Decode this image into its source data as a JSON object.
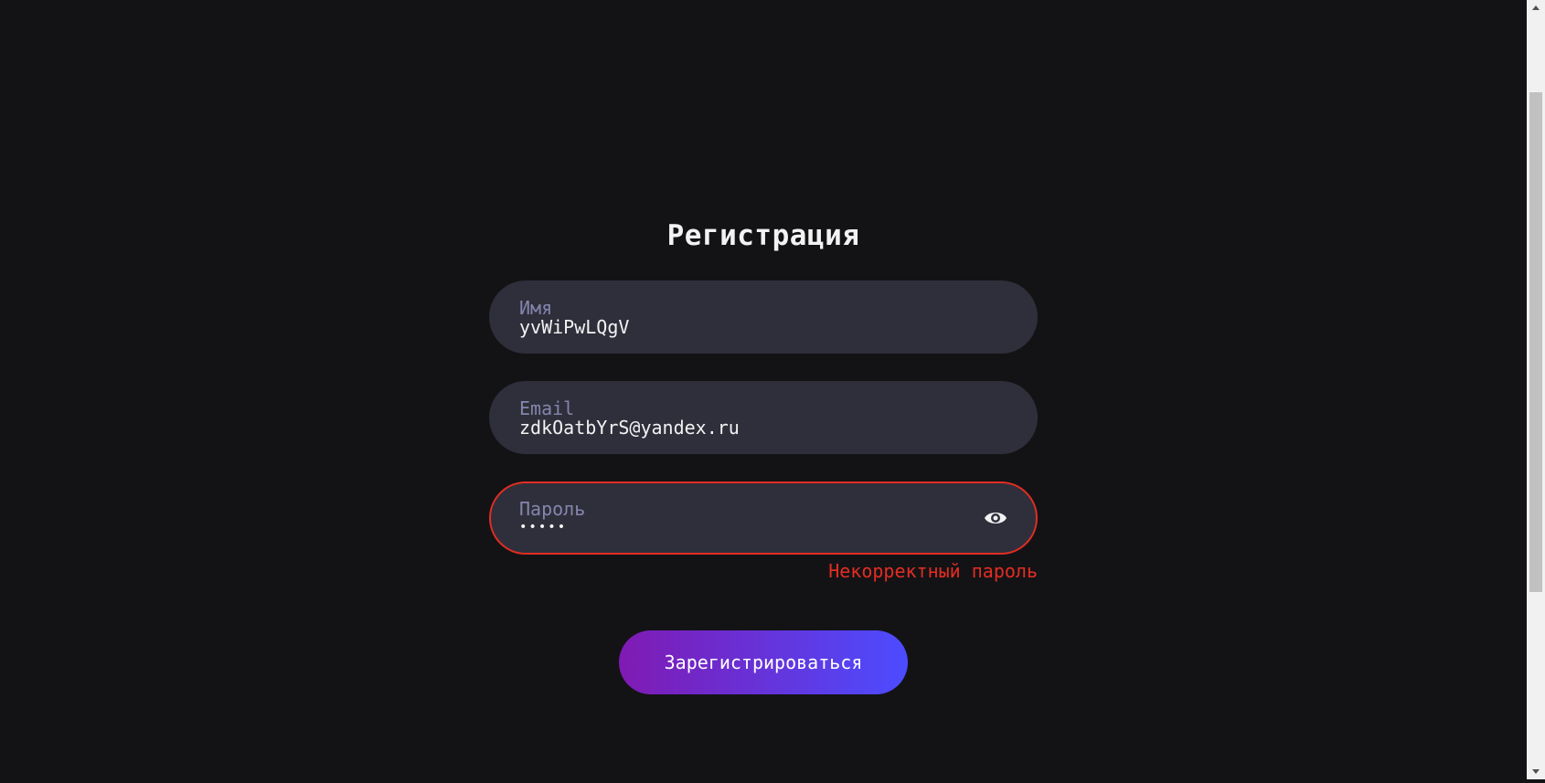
{
  "form": {
    "title": "Регистрация",
    "name_field": {
      "label": "Имя",
      "value": "yvWiPwLQgV"
    },
    "email_field": {
      "label": "Email",
      "value": "zdkOatbYrS@yandex.ru"
    },
    "password_field": {
      "label": "Пароль",
      "value_masked": "•••••",
      "icon": "eye-icon"
    },
    "error_message": "Некорректный пароль",
    "submit_label": "Зарегистрироваться"
  },
  "colors": {
    "background": "#131316",
    "field_bg": "#2f2f3b",
    "label": "#8585ad",
    "error": "#e32d22",
    "button_gradient_start": "#801ab3",
    "button_gradient_end": "#4c4cff"
  },
  "scrollbar": {
    "position_fraction": 0.12
  }
}
